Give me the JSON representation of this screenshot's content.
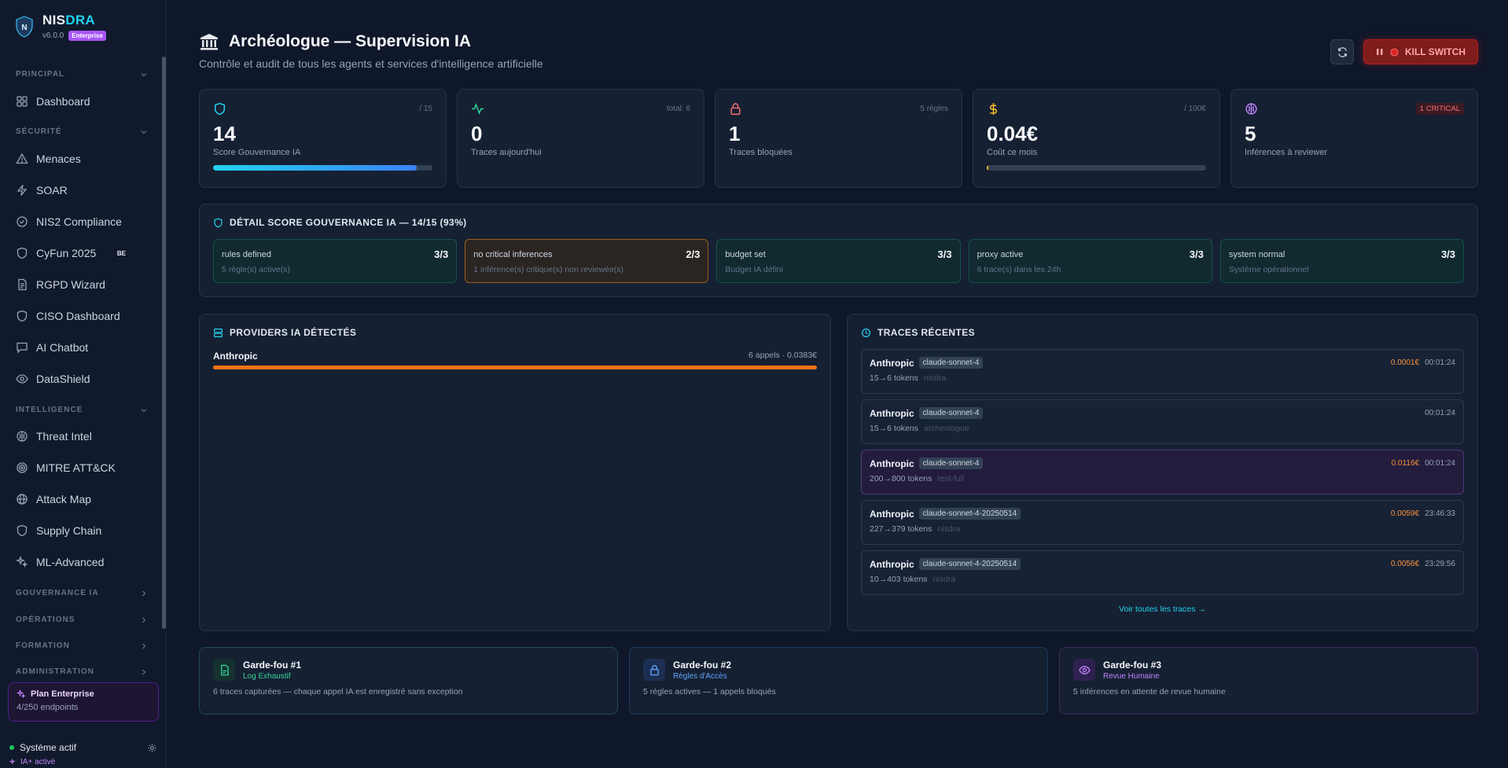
{
  "brand": {
    "name_main": "NIS",
    "name_accent": "DRA",
    "version": "v6.0.0",
    "edition": "Enterprise"
  },
  "sidebar": {
    "sections": [
      {
        "label": "PRINCIPAL"
      },
      {
        "label": "SÉCURITÉ"
      },
      {
        "label": "INTELLIGENCE"
      },
      {
        "label": "GOUVERNANCE IA"
      },
      {
        "label": "OPÉRATIONS"
      },
      {
        "label": "FORMATION"
      },
      {
        "label": "ADMINISTRATION"
      }
    ],
    "items": [
      {
        "label": "Dashboard",
        "icon": "dashboard-icon"
      },
      {
        "label": "Menaces",
        "icon": "warning-icon"
      },
      {
        "label": "SOAR",
        "icon": "bolt-icon"
      },
      {
        "label": "NIS2 Compliance",
        "icon": "check-circle-icon"
      },
      {
        "label": "CyFun 2025",
        "icon": "shield-icon",
        "tag": "BE"
      },
      {
        "label": "RGPD Wizard",
        "icon": "document-icon"
      },
      {
        "label": "CISO Dashboard",
        "icon": "shield-icon"
      },
      {
        "label": "AI Chatbot",
        "icon": "chat-icon"
      },
      {
        "label": "DataShield",
        "icon": "eye-icon"
      },
      {
        "label": "Threat Intel",
        "icon": "brain-icon"
      },
      {
        "label": "MITRE ATT&CK",
        "icon": "target-icon"
      },
      {
        "label": "Attack Map",
        "icon": "globe-icon"
      },
      {
        "label": "Supply Chain",
        "icon": "shield-icon"
      },
      {
        "label": "ML-Advanced",
        "icon": "sparkles-icon"
      }
    ],
    "plan": {
      "title": "Plan Enterprise",
      "sub": "4/250 endpoints"
    },
    "status": "Système actif",
    "ia_status": "IA+ activé"
  },
  "header": {
    "title": "Archéologue — Supervision IA",
    "subtitle": "Contrôle et audit de tous les agents et services d'intelligence artificielle",
    "kill_label": "KILL SWITCH"
  },
  "stats": [
    {
      "icon": "shield-icon",
      "corner": "/ 15",
      "value": "14",
      "label": "Score Gouvernance IA",
      "progress": 0.93,
      "color": "#22d3ee"
    },
    {
      "icon": "activity-icon",
      "corner": "total: 6",
      "value": "0",
      "label": "Traces aujourd'hui",
      "color": "#34d399"
    },
    {
      "icon": "lock-icon",
      "corner": "5 règles",
      "value": "1",
      "label": "Traces bloquées",
      "color": "#f87171"
    },
    {
      "icon": "dollar-icon",
      "corner": "/ 100€",
      "value": "0.04€",
      "label": "Coût ce mois",
      "progress": 0.0004,
      "color": "#fbbf24"
    },
    {
      "icon": "brain-icon",
      "corner": "1 CRITICAL",
      "value": "5",
      "label": "Inférences à reviewer",
      "color": "#c084fc"
    }
  ],
  "detail": {
    "title": "DÉTAIL SCORE GOUVERNANCE IA — 14/15 (93%)",
    "rules": [
      {
        "name": "rules defined",
        "score": "3/3",
        "desc": "5 règle(s) active(s)",
        "status": "ok"
      },
      {
        "name": "no critical inferences",
        "score": "2/3",
        "desc": "1 inférence(s) critique(s) non reviewée(s)",
        "status": "warn"
      },
      {
        "name": "budget set",
        "score": "3/3",
        "desc": "Budget IA défini",
        "status": "ok"
      },
      {
        "name": "proxy active",
        "score": "3/3",
        "desc": "6 trace(s) dans les 24h",
        "status": "ok"
      },
      {
        "name": "system normal",
        "score": "3/3",
        "desc": "Système opérationnel",
        "status": "ok"
      }
    ]
  },
  "providers": {
    "title": "PROVIDERS IA DÉTECTÉS",
    "items": [
      {
        "name": "Anthropic",
        "meta": "6 appels · 0.0383€",
        "share": 1.0
      }
    ]
  },
  "traces": {
    "title": "TRACES RÉCENTES",
    "items": [
      {
        "provider": "Anthropic",
        "model": "claude-sonnet-4",
        "cost": "0.0001€",
        "time": "00:01:24",
        "tokens": "15→6 tokens",
        "agent": "nisdra",
        "highlight": false
      },
      {
        "provider": "Anthropic",
        "model": "claude-sonnet-4",
        "cost": "",
        "time": "00:01:24",
        "tokens": "15→6 tokens",
        "agent": "archeologue",
        "highlight": false
      },
      {
        "provider": "Anthropic",
        "model": "claude-sonnet-4",
        "cost": "0.0116€",
        "time": "00:01:24",
        "tokens": "200→800 tokens",
        "agent": "test-full",
        "highlight": true
      },
      {
        "provider": "Anthropic",
        "model": "claude-sonnet-4-20250514",
        "cost": "0.0059€",
        "time": "23:46:33",
        "tokens": "227→379 tokens",
        "agent": "nisdra",
        "highlight": false
      },
      {
        "provider": "Anthropic",
        "model": "claude-sonnet-4-20250514",
        "cost": "0.0056€",
        "time": "23:29:56",
        "tokens": "10→403 tokens",
        "agent": "nisdra",
        "highlight": false
      }
    ],
    "see_all": "Voir toutes les traces →"
  },
  "guardrails": [
    {
      "title": "Garde-fou #1",
      "sub": "Log Exhaustif",
      "desc": "6 traces capturées — chaque appel IA est enregistré sans exception",
      "color": "#34d399",
      "icon": "file-log-icon"
    },
    {
      "title": "Garde-fou #2",
      "sub": "Règles d'Accès",
      "desc": "5 règles actives — 1 appels bloqués",
      "color": "#60a5fa",
      "icon": "lock-icon"
    },
    {
      "title": "Garde-fou #3",
      "sub": "Revue Humaine",
      "desc": "5 inférences en attente de revue humaine",
      "color": "#c084fc",
      "icon": "eye-icon"
    }
  ]
}
